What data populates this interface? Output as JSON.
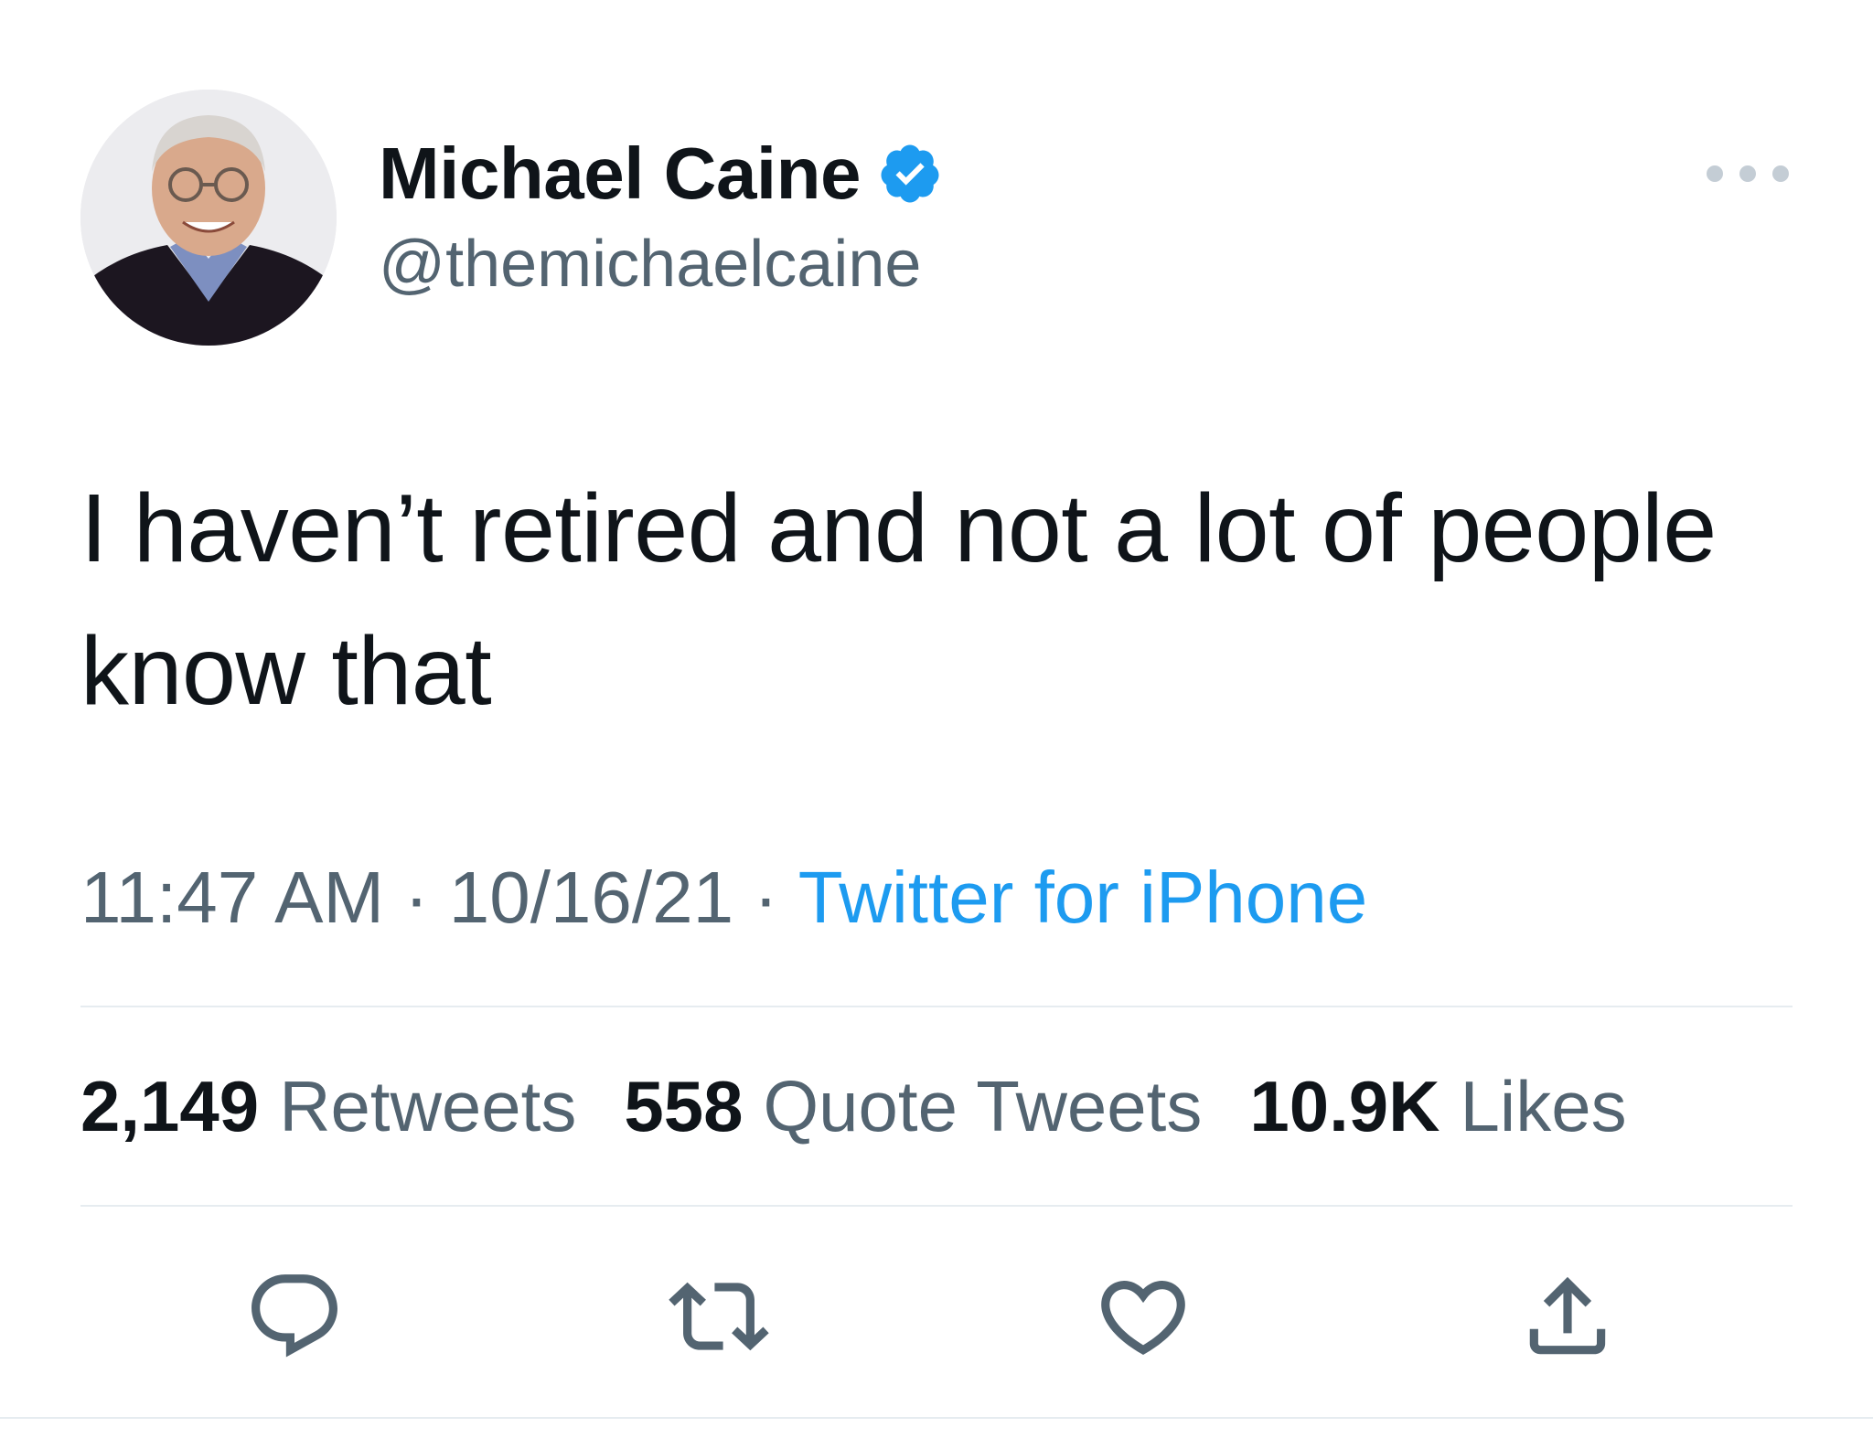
{
  "author": {
    "display_name": "Michael Caine",
    "handle": "@themichaelcaine",
    "verified": true
  },
  "tweet": {
    "text": "I haven’t retired and not a lot of people know that",
    "time": "11:47 AM",
    "date": "10/16/21",
    "separator": "·",
    "source": "Twitter for iPhone"
  },
  "stats": {
    "retweets": {
      "count": "2,149",
      "label": "Retweets"
    },
    "quotes": {
      "count": "558",
      "label": "Quote Tweets"
    },
    "likes": {
      "count": "10.9K",
      "label": "Likes"
    }
  },
  "icons": {
    "more": "more-horizontal-icon",
    "verified": "verified-badge-icon",
    "reply": "reply-icon",
    "retweet": "retweet-icon",
    "like": "heart-icon",
    "share": "share-icon"
  },
  "colors": {
    "text": "#0f1419",
    "secondary": "#536471",
    "accent": "#1d9bf0",
    "divider": "#e6ecf0"
  }
}
